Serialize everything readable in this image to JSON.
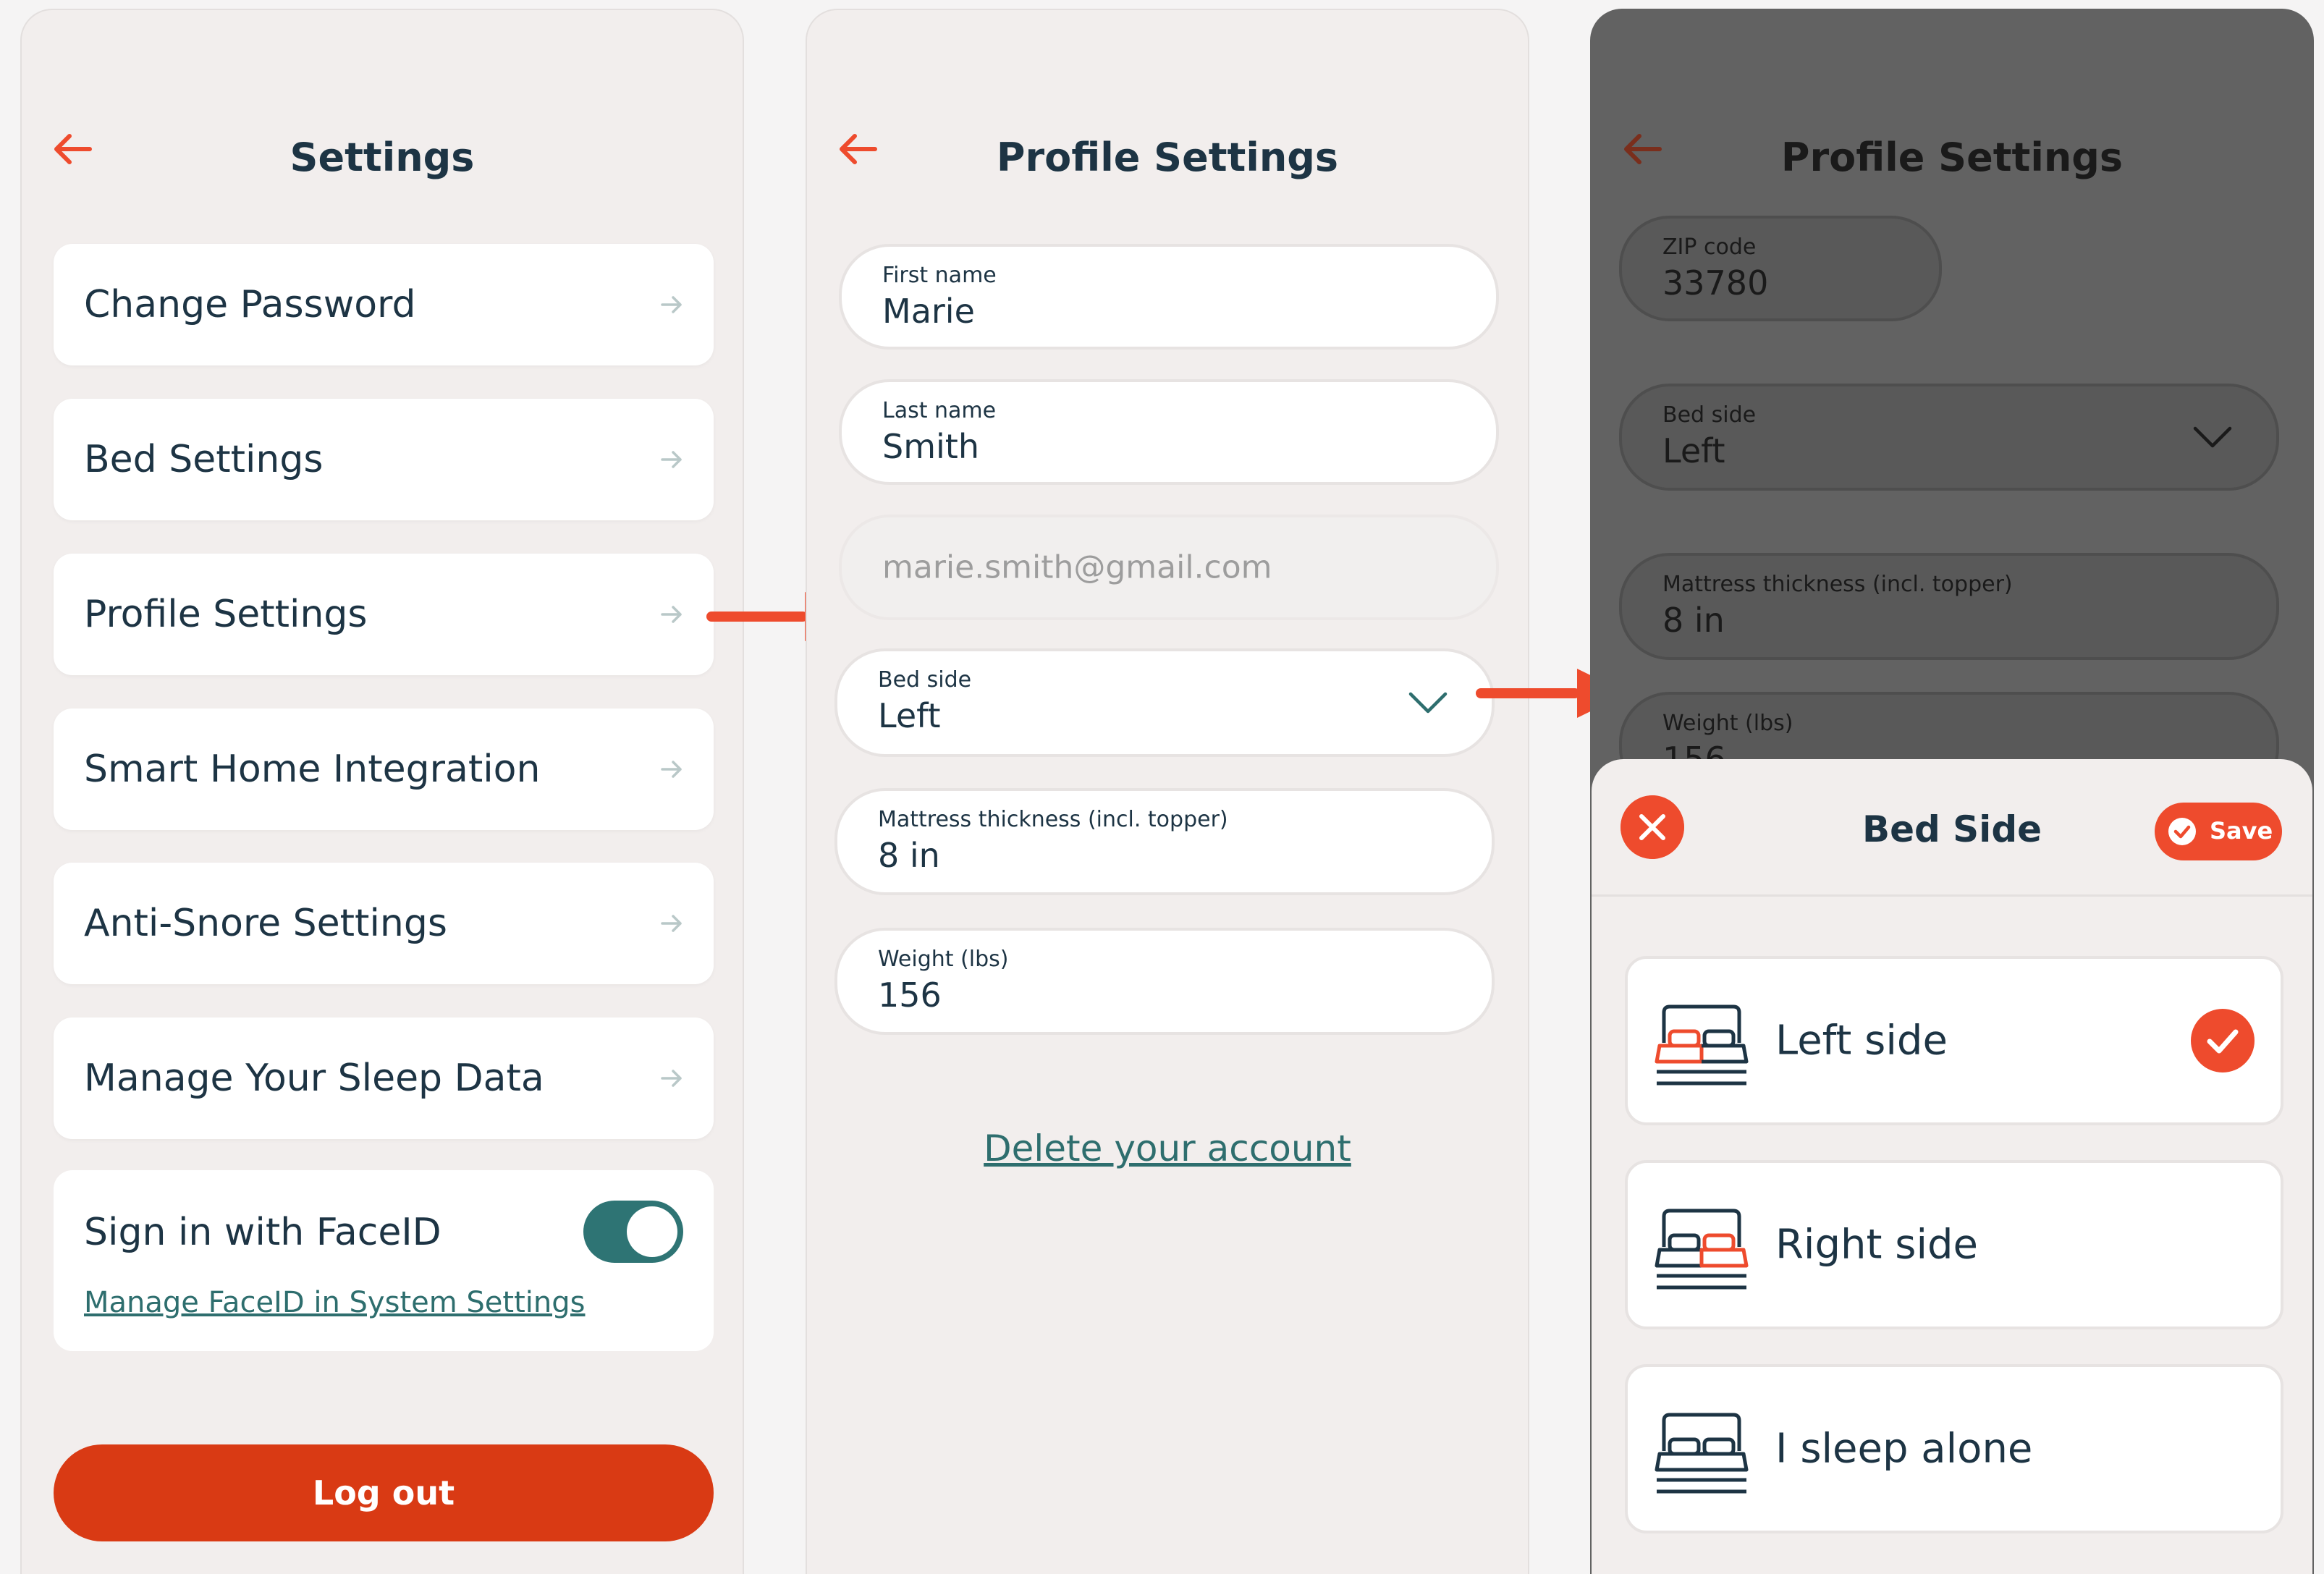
{
  "colors": {
    "accent": "#ee4b2d",
    "logout": "#d93a14",
    "teal": "#2e7474",
    "text": "#1d3444",
    "background": "#f2eeed",
    "overlay": "#626262"
  },
  "settings_screen": {
    "title": "Settings",
    "back_icon": "arrow-left-icon",
    "menu_items": [
      {
        "label": "Change Password",
        "icon": "arrow-right-icon"
      },
      {
        "label": "Bed Settings",
        "icon": "arrow-right-icon"
      },
      {
        "label": "Profile Settings",
        "icon": "arrow-right-icon"
      },
      {
        "label": "Smart Home Integration",
        "icon": "arrow-right-icon"
      },
      {
        "label": "Anti-Snore Settings",
        "icon": "arrow-right-icon"
      },
      {
        "label": "Manage Your Sleep Data",
        "icon": "arrow-right-icon"
      }
    ],
    "faceid": {
      "label": "Sign in with FaceID",
      "enabled": true,
      "link": "Manage FaceID in System Settings"
    },
    "logout_label": "Log out"
  },
  "profile_screen": {
    "title": "Profile Settings",
    "first_name": {
      "label": "First name",
      "value": "Marie"
    },
    "last_name": {
      "label": "Last name",
      "value": "Smith"
    },
    "email": {
      "placeholder": "marie.smith@gmail.com"
    },
    "bed_side": {
      "label": "Bed side",
      "value": "Left"
    },
    "mattress": {
      "label": "Mattress thickness (incl. topper)",
      "value": "8 in"
    },
    "weight": {
      "label": "Weight (lbs)",
      "value": "156"
    },
    "delete_link": "Delete your account"
  },
  "bed_side_screen": {
    "title": "Profile Settings",
    "zip": {
      "label": "ZIP code",
      "value": "33780"
    },
    "bed_side": {
      "label": "Bed side",
      "value": "Left"
    },
    "mattress": {
      "label": "Mattress thickness (incl. topper)",
      "value": "8 in"
    },
    "weight": {
      "label": "Weight (lbs)",
      "value": "156"
    },
    "sheet": {
      "title": "Bed Side",
      "save_label": "Save",
      "close_icon": "close-icon",
      "options": [
        {
          "label": "Left side",
          "icon": "bed-left-icon",
          "selected": true
        },
        {
          "label": "Right side",
          "icon": "bed-right-icon",
          "selected": false
        },
        {
          "label": "I sleep alone",
          "icon": "bed-alone-icon",
          "selected": false
        }
      ]
    }
  }
}
